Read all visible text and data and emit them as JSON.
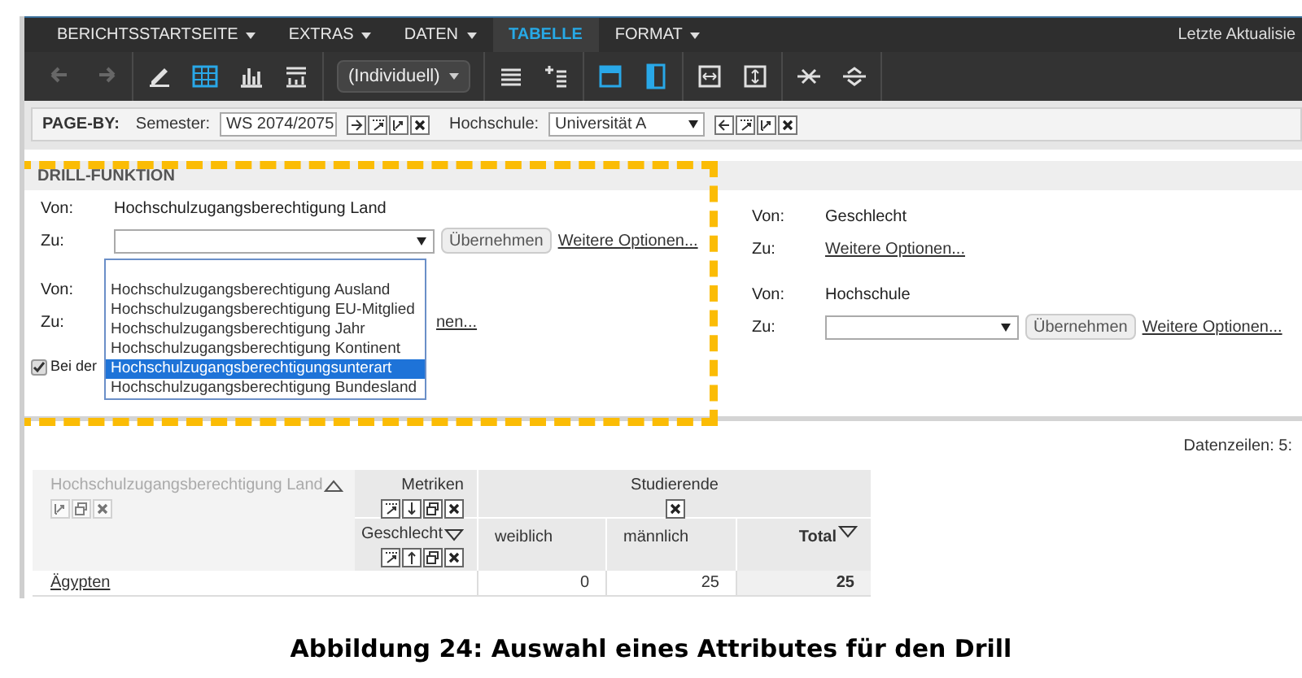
{
  "menu": {
    "items": [
      {
        "label": "BERICHTSSTARTSEITE",
        "caret": true,
        "selected": false
      },
      {
        "label": "EXTRAS",
        "caret": true,
        "selected": false
      },
      {
        "label": "DATEN",
        "caret": true,
        "selected": false
      },
      {
        "label": "TABELLE",
        "caret": false,
        "selected": true
      },
      {
        "label": "FORMAT",
        "caret": true,
        "selected": false
      }
    ],
    "status": "Letzte Aktualisie"
  },
  "toolbar": {
    "groups": [
      {
        "items": [
          {
            "kind": "undo",
            "disabled": true,
            "active": false
          },
          {
            "kind": "redo",
            "disabled": true,
            "active": false
          }
        ]
      },
      {
        "items": [
          {
            "kind": "pencil",
            "disabled": false,
            "active": false
          },
          {
            "kind": "grid",
            "disabled": false,
            "active": true
          },
          {
            "kind": "bars",
            "disabled": false,
            "active": false
          },
          {
            "kind": "grid-bars",
            "disabled": false,
            "active": false
          }
        ]
      },
      {
        "items": [
          {
            "kind": "select",
            "label": "(Individuell)"
          }
        ]
      },
      {
        "items": [
          {
            "kind": "lines",
            "disabled": false,
            "active": false
          },
          {
            "kind": "plus-lines",
            "disabled": false,
            "active": false
          }
        ]
      },
      {
        "items": [
          {
            "kind": "header-row",
            "disabled": false,
            "active": true
          },
          {
            "kind": "header-column",
            "disabled": false,
            "active": true
          }
        ]
      },
      {
        "items": [
          {
            "kind": "fit-width",
            "disabled": false,
            "active": false
          },
          {
            "kind": "fit-height",
            "disabled": false,
            "active": false
          }
        ]
      },
      {
        "items": [
          {
            "kind": "collapse",
            "disabled": false,
            "active": false
          },
          {
            "kind": "expand",
            "disabled": false,
            "active": false
          }
        ]
      }
    ]
  },
  "page_by": {
    "label": "PAGE-BY:",
    "filters": [
      {
        "label": "Semester:",
        "value": "WS 2074/2075",
        "buttons": [
          {
            "kind": "right"
          },
          {
            "kind": "pivot"
          },
          {
            "kind": "drill"
          },
          {
            "kind": "remove"
          }
        ]
      },
      {
        "label": "Hochschule:",
        "value": "Universität A",
        "buttons": [
          {
            "kind": "left"
          },
          {
            "kind": "pivot"
          },
          {
            "kind": "drill"
          },
          {
            "kind": "remove"
          }
        ]
      }
    ]
  },
  "drill": {
    "title": "DRILL-FUNKTION",
    "left": [
      {
        "from_label": "Von:",
        "from_value": "Hochschulzugangsberechtigung Land",
        "to_label": "Zu:",
        "select": {
          "open": true,
          "options": [
            {
              "label": "Hochschulzugangsberechtigung Ausland",
              "selected": false
            },
            {
              "label": "Hochschulzugangsberechtigung EU-Mitglied",
              "selected": false
            },
            {
              "label": "Hochschulzugangsberechtigung Jahr",
              "selected": false
            },
            {
              "label": "Hochschulzugangsberechtigung Kontinent",
              "selected": false
            },
            {
              "label": "Hochschulzugangsberechtigungsunterart",
              "selected": true
            },
            {
              "label": "Hochschulzugangsberechtigung Bundesland",
              "selected": false
            }
          ]
        },
        "apply": "Übernehmen",
        "more": "Weitere Optionen..."
      },
      {
        "from_label": "Von:",
        "to_label": "Zu:",
        "more": "nen..."
      }
    ],
    "checkbox": {
      "label": "Bei der",
      "checked": true
    },
    "right": [
      {
        "from_label": "Von:",
        "from_value": "Geschlecht",
        "to_label": "Zu:",
        "more": "Weitere Optionen..."
      },
      {
        "from_label": "Von:",
        "from_value": "Hochschule",
        "to_label": "Zu:",
        "select": {
          "open": false
        },
        "apply": "Übernehmen",
        "more": "Weitere Optionen..."
      }
    ]
  },
  "row_count": "Datenzeilen: 5:",
  "table": {
    "attribute_header": "Hochschulzugangsberechtigung Land",
    "metrics_header": "Metriken",
    "measure_header": "Studierende",
    "column_attribute": "Geschlecht",
    "columns": [
      {
        "label": "weiblich",
        "total": false
      },
      {
        "label": "männlich",
        "total": false
      },
      {
        "label": "Total",
        "total": true
      }
    ],
    "rows": [
      {
        "label": "Ägypten",
        "values": [
          "0",
          "25",
          "25"
        ]
      }
    ]
  },
  "caption": "Abbildung 24: Auswahl eines Attributes für den Drill"
}
